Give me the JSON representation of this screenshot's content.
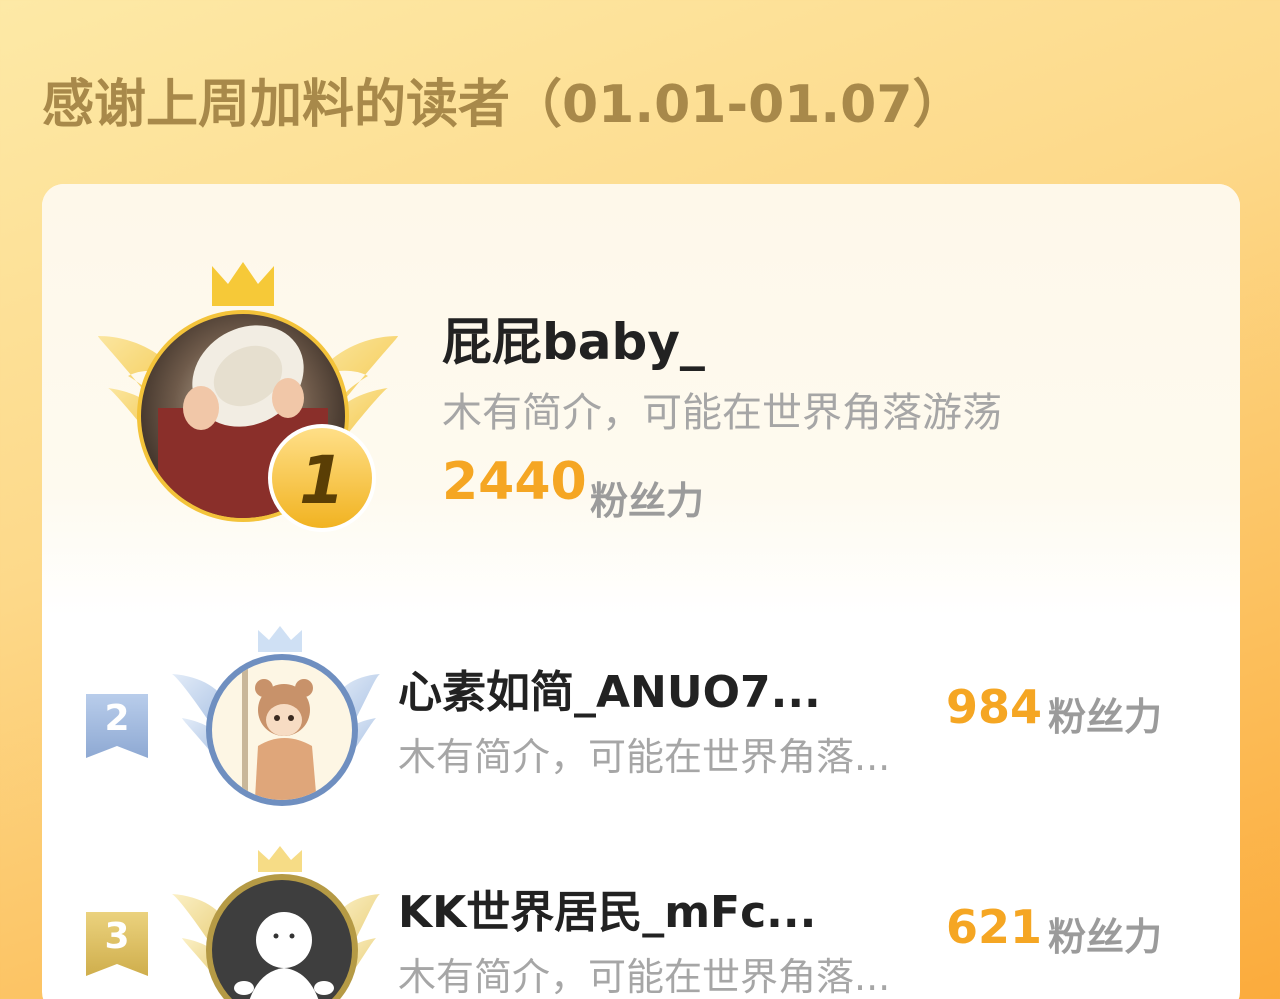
{
  "header": {
    "title": "感谢上周加料的读者（01.01-01.07）"
  },
  "colors": {
    "accent": "#f5a623",
    "gold": "#f3c33a",
    "silver_blue": "#9fb8dc",
    "bronze_gold": "#d8b656"
  },
  "top_reader": {
    "rank": "1",
    "name": "屁屁baby_",
    "bio": "木有简介，可能在世界角落游荡",
    "score": "2440",
    "unit": "粉丝力",
    "avatar": "child-with-plate-avatar"
  },
  "readers": [
    {
      "rank": "2",
      "name": "心素如简_ANUO7...",
      "bio": "木有简介，可能在世界角落...",
      "score": "984",
      "unit": "粉丝力",
      "avatar": "bear-hood-kid-avatar"
    },
    {
      "rank": "3",
      "name": "KK世界居民_mFc...",
      "bio": "木有简介，可能在世界角落...",
      "score": "621",
      "unit": "粉丝力",
      "avatar": "default-white-figure-avatar"
    }
  ]
}
